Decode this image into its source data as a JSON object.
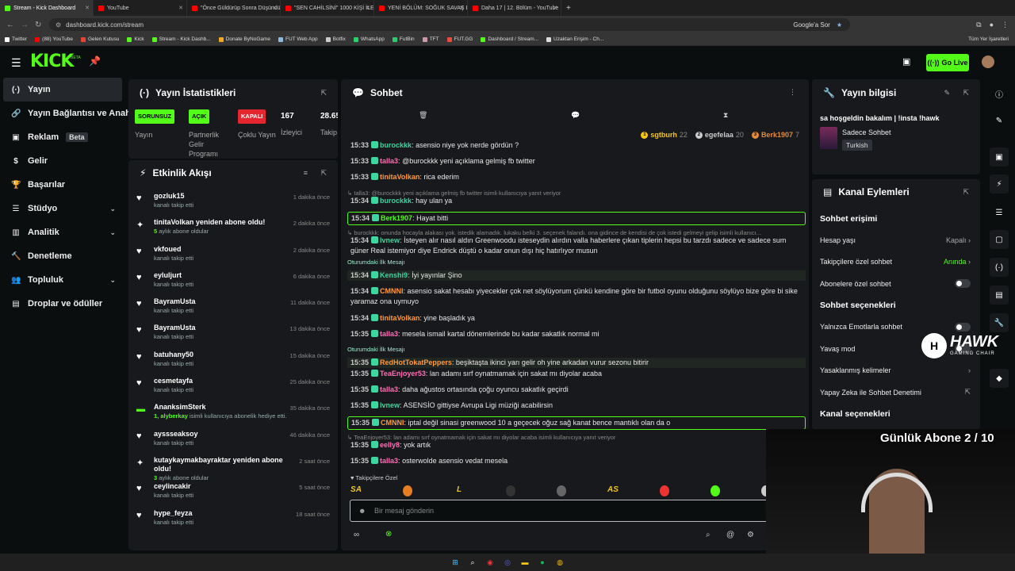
{
  "browser": {
    "tabs": [
      {
        "title": "Stream - Kick Dashboard",
        "color": "#53fc18",
        "active": true
      },
      {
        "title": "YouTube",
        "color": "#ff0000"
      },
      {
        "title": "\"Önce Güldürüp Sonra Düşündü...",
        "color": "#ff0000"
      },
      {
        "title": "\"SEN CAHİLSİNİ\" 1000 KİŞİ İLE...",
        "color": "#ff0000"
      },
      {
        "title": "YENİ BÖLÜM: SOĞUK SAVAŞ EN...",
        "color": "#ff0000"
      },
      {
        "title": "Daha 17 | 12. Bölüm - YouTube",
        "color": "#ff0000"
      }
    ],
    "url": "dashboard.kick.com/stream",
    "google_btn": "Google'a Sor",
    "bookmarks": [
      {
        "label": "Twitter",
        "color": "#ffffff"
      },
      {
        "label": "(88) YouTube",
        "color": "#ff0000"
      },
      {
        "label": "Gelen Kutusu",
        "color": "#ea4335"
      },
      {
        "label": "Kick",
        "color": "#53fc18"
      },
      {
        "label": "Stream - Kick Dashb...",
        "color": "#53fc18"
      },
      {
        "label": "Donate ByNoGame",
        "color": "#f5a623"
      },
      {
        "label": "FUT Web App",
        "color": "#8bd"
      },
      {
        "label": "Botfix",
        "color": "#ccc"
      },
      {
        "label": "WhatsApp",
        "color": "#25d366"
      },
      {
        "label": "FutBin",
        "color": "#2ecc71"
      },
      {
        "label": "TFT",
        "color": "#c9a"
      },
      {
        "label": "FUT.GG",
        "color": "#e74c3c"
      },
      {
        "label": "Dashboard / Stream...",
        "color": "#53fc18"
      },
      {
        "label": "Uzaktan Erişim - Ch...",
        "color": "#ddd"
      }
    ],
    "all_bookmarks": "Tüm Yer İşaretleri"
  },
  "header": {
    "logo": "KICK",
    "logo_sup": "BETA",
    "go_live": "Go Live"
  },
  "sidebar": {
    "items": [
      {
        "label": "Yayın",
        "icon": "(·)",
        "active": true
      },
      {
        "label": "Yayın Bağlantısı ve Anahtarı",
        "icon": "🔗"
      },
      {
        "label": "Reklam",
        "icon": "▣",
        "badge": "Beta"
      },
      {
        "label": "Gelir",
        "icon": "$"
      },
      {
        "label": "Başarılar",
        "icon": "🏆"
      },
      {
        "label": "Stüdyo",
        "icon": "☰",
        "chevron": true
      },
      {
        "label": "Analitik",
        "icon": "▥",
        "chevron": true
      },
      {
        "label": "Denetleme",
        "icon": "🔨"
      },
      {
        "label": "Topluluk",
        "icon": "👥",
        "chevron": true
      },
      {
        "label": "Droplar ve ödüller",
        "icon": "▤"
      }
    ]
  },
  "stats": {
    "title": "Yayın İstatistikleri",
    "items": [
      {
        "pill": "SORUNSUZ",
        "label": "Yayın",
        "color": "#53fc18"
      },
      {
        "pill": "AÇIK",
        "label": "Partnerlik Gelir Programı",
        "color": "#53fc18"
      },
      {
        "pill": "KAPALI",
        "label": "Çoklu Yayın",
        "color": "#e5262e"
      },
      {
        "value": "167",
        "label": "İzleyici"
      },
      {
        "value": "28.65",
        "label": "Takip"
      }
    ]
  },
  "activity": {
    "title": "Etkinlik Akışı",
    "items": [
      {
        "who": "gozluk15",
        "sub": "kanalı takip etti",
        "time": "1 dakika önce",
        "icon": "heart"
      },
      {
        "who": "tinitaVolkan yeniden abone oldu!",
        "sub_hl": "5",
        "sub": "aylık abone oldular",
        "time": "2 dakika önce",
        "icon": "star"
      },
      {
        "who": "vkfoued",
        "sub": "kanalı takip etti",
        "time": "2 dakika önce",
        "icon": "heart"
      },
      {
        "who": "eyluljurt",
        "sub": "kanalı takip etti",
        "time": "6 dakika önce",
        "icon": "heart"
      },
      {
        "who": "BayramUsta",
        "sub": "kanalı takip etti",
        "time": "11 dakika önce",
        "icon": "heart"
      },
      {
        "who": "BayramUsta",
        "sub": "kanalı takip etti",
        "time": "13 dakika önce",
        "icon": "heart"
      },
      {
        "who": "batuhany50",
        "sub": "kanalı takip etti",
        "time": "15 dakika önce",
        "icon": "heart"
      },
      {
        "who": "cesmetayfa",
        "sub": "kanalı takip etti",
        "time": "25 dakika önce",
        "icon": "heart"
      },
      {
        "who": "AnanksimSterk",
        "sub_hl": "1, alyberkay",
        "sub": "isimli kullanıcıya abonelik hediye etti.",
        "time": "35 dakika önce",
        "icon": "gift"
      },
      {
        "who": "ayssseaksoy",
        "sub": "kanalı takip etti",
        "time": "46 dakika önce",
        "icon": "heart"
      },
      {
        "who": "kutaykaymakbayraktar yeniden abone oldu!",
        "sub_hl": "3",
        "sub": "aylık abone oldular",
        "time": "2 saat önce",
        "icon": "star"
      },
      {
        "who": "ceylincakir",
        "sub": "kanalı takip etti",
        "time": "5 saat önce",
        "icon": "heart"
      },
      {
        "who": "hype_feyza",
        "sub": "kanalı takip etti",
        "time": "18 saat önce",
        "icon": "heart"
      }
    ]
  },
  "chat": {
    "title": "Sohbet",
    "top_users": [
      {
        "name": "sgtburh",
        "count": "22",
        "medal": "1",
        "color": "#f5c518"
      },
      {
        "name": "egefelaa",
        "count": "20",
        "medal": "2",
        "color": "#ccc"
      },
      {
        "name": "Berk1907",
        "count": "7",
        "medal": "3",
        "color": "#e08c3c"
      }
    ],
    "messages": [
      {
        "time": "15:33",
        "user": "burockkk",
        "color": "#3dd6a0",
        "text": "asensio niye yok nerde gördün ?"
      },
      {
        "time": "15:33",
        "user": "talla3",
        "color": "#ff6fb5",
        "text": "@burockkk yeni açıklama gelmiş fb twitter"
      },
      {
        "time": "15:33",
        "user": "tinitaVolkan",
        "color": "#ff9a3c",
        "text": "rica ederim"
      },
      {
        "reply": "talla3: @burockkk yeni açıklama gelmiş fb twitter isimli kullanıcıya yanıt veriyor"
      },
      {
        "time": "15:34",
        "user": "burockkk",
        "color": "#3dd6a0",
        "text": "hay ulan ya"
      },
      {
        "time": "15:34",
        "user": "Berk1907",
        "color": "#53fc18",
        "text": "Hayat bitti"
      },
      {
        "reply": "burockkk: onunda hocayla alakası yok. istedik alamadık. lukaku belki 3. seçenek falandı. ona gidince de kendisi de çok istedi gelmeyi gelip isimli kullanıcı..."
      },
      {
        "time": "15:34",
        "user": "lvnew",
        "color": "#3dd6a0",
        "text": "İsteyen alır nasıl aldın Greenwoodu isteseydin alırdın valla haberlere çıkan tiplerin hepsi bu tarzdı sadece ve sadece sum güner Real istemiyor diye Endrick düştü o kadar onun dışı hiç hatırlıyor musun"
      },
      {
        "label": "Oturumdaki İlk Mesajı"
      },
      {
        "time": "15:34",
        "user": "Kenshi9",
        "color": "#3dd6a0",
        "text": "İyi yayınlar Şino"
      },
      {
        "time": "15:34",
        "user": "CMNNI",
        "color": "#ff9a3c",
        "text": "asensio sakat hesabı yiyecekler çok net söylüyorum çünkü kendine göre bir futbol oyunu olduğunu söylüyo bize göre bi sike yaramaz ona uymuyo"
      },
      {
        "time": "15:34",
        "user": "tinitaVolkan",
        "color": "#ff9a3c",
        "text": "yine başladık ya"
      },
      {
        "time": "15:35",
        "user": "talla3",
        "color": "#ff6fb5",
        "text": "mesela ismail kartal dönemlerinde bu kadar sakatlık normal mi"
      },
      {
        "label": "Oturumdaki İlk Mesajı"
      },
      {
        "time": "15:35",
        "user": "RedHotTokatPeppers",
        "color": "#ff9a3c",
        "text": "beşiktaşta ikinci yarı gelir oh yine arkadan vurur sezonu bitirir"
      },
      {
        "time": "15:35",
        "user": "TeaEnjoyer53",
        "color": "#ff6fb5",
        "text": "lan adamı sırf oynatmamak için sakat mı diyolar acaba"
      },
      {
        "time": "15:35",
        "user": "talla3",
        "color": "#ff6fb5",
        "text": "daha ağustos ortasında çoğu oyuncu sakatlık geçirdi"
      },
      {
        "time": "15:35",
        "user": "lvnew",
        "color": "#3dd6a0",
        "text": "ASENSİO gittiyse Avrupa Ligi müziği acabilirsin"
      },
      {
        "time": "15:35",
        "user": "CMNNI",
        "color": "#ff9a3c",
        "text": "iptal değil sinasi greenwood 10 a geçecek oğuz sağ kanat bence mantıklı olan da o"
      },
      {
        "reply": "TeaEnjoyer53: lan adamı sırf oynatmamak için sakat mı diyolar acaba isimli kullanıcıya yanıt veriyor"
      },
      {
        "time": "15:35",
        "user": "eelly8",
        "color": "#ff6fb5",
        "text": "yok artık"
      },
      {
        "time": "15:35",
        "user": "talla3",
        "color": "#ff6fb5",
        "text": "osterwolde asensio vedat mesela"
      }
    ],
    "follower_label": "Takipçilere Özel",
    "input_placeholder": "Bir mesaj gönderin",
    "emote_labels": [
      "SA",
      "",
      "L",
      "",
      "",
      "AS",
      "",
      "",
      ""
    ]
  },
  "stream_info": {
    "title": "Yayın bilgisi",
    "stream_title": "sa hoşgeldin bakalım | !insta !hawk",
    "category": "Sadece Sohbet",
    "language": "Turkish"
  },
  "channel": {
    "title": "Kanal Eylemleri",
    "chat_access": "Sohbet erişimi",
    "account_age": "Hesap yaşı",
    "account_age_val": "Kapalı",
    "followers_only": "Takipçilere özel sohbet",
    "followers_only_val": "Anında",
    "subs_only": "Abonelere özel sohbet",
    "chat_options": "Sohbet seçenekleri",
    "emote_only": "Yalnızca Emotlarla sohbet",
    "slow_mode": "Yavaş mod",
    "banned_words": "Yasaklanmış kelimeler",
    "ai_mod": "Yapay Zeka ile Sohbet Denetimi",
    "channel_options": "Kanal seçenekleri"
  },
  "overlay": {
    "sub_goal": "Günlük Abone 2 / 10",
    "brand": "HAWK",
    "brand_sub": "GAMING CHAIR"
  }
}
